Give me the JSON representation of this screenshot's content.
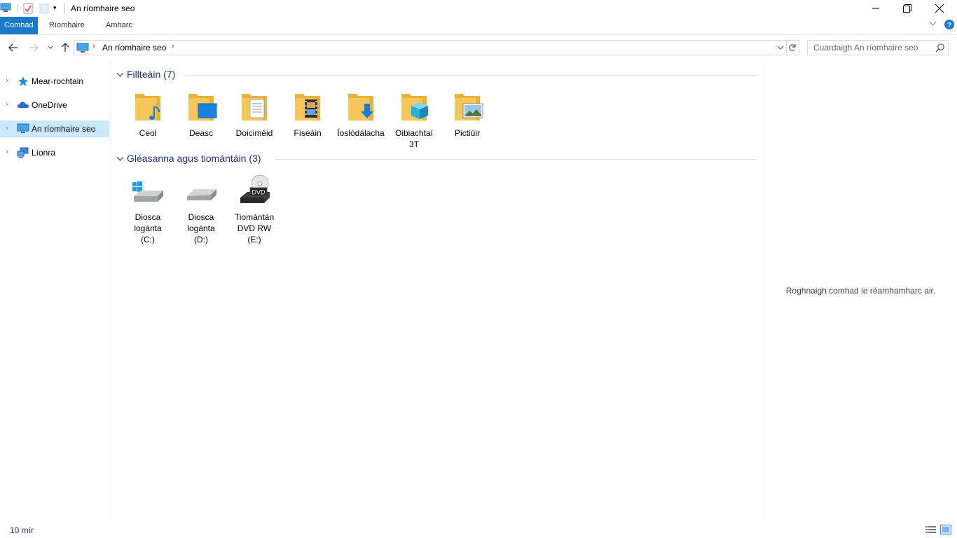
{
  "window": {
    "title": "An ríomhaire seo",
    "controls": {
      "minimize": "—",
      "maximize": "❐",
      "close": "✕"
    }
  },
  "ribbon": {
    "tabs": [
      {
        "label": "Comhad",
        "active": true
      },
      {
        "label": "Ríomhaire",
        "active": false
      },
      {
        "label": "Amharc",
        "active": false
      }
    ],
    "help_icon": "help-icon"
  },
  "address": {
    "path": [
      "An ríomhaire seo"
    ],
    "search_placeholder": "Cuardaigh An ríomhaire seo"
  },
  "nav": {
    "items": [
      {
        "label": "Mear-rochtain",
        "icon": "star-icon",
        "selected": false
      },
      {
        "label": "OneDrive",
        "icon": "cloud-icon",
        "selected": false
      },
      {
        "label": "An ríomhaire seo",
        "icon": "computer-icon",
        "selected": true
      },
      {
        "label": "Líonra",
        "icon": "network-icon",
        "selected": false
      }
    ]
  },
  "content": {
    "folders_group": "Fillteáin (7)",
    "folders": [
      {
        "label": "Ceol",
        "icon": "music-folder-icon"
      },
      {
        "label": "Deasc",
        "icon": "desktop-folder-icon"
      },
      {
        "label": "Doiciméid",
        "icon": "documents-folder-icon"
      },
      {
        "label": "Físeáin",
        "icon": "videos-folder-icon"
      },
      {
        "label": "Íoslódálacha",
        "icon": "downloads-folder-icon"
      },
      {
        "label": "Oibiachtaí 3T",
        "icon": "3d-objects-folder-icon"
      },
      {
        "label": "Pictiúir",
        "icon": "pictures-folder-icon"
      }
    ],
    "devices_group": "Gléasanna agus tiomántáin (3)",
    "devices": [
      {
        "label": "Diosca logánta (C:)",
        "icon": "windows-drive-icon"
      },
      {
        "label": "Diosca logánta (D:)",
        "icon": "drive-icon"
      },
      {
        "label": "Tiomántán DVD RW (E:)",
        "icon": "dvd-drive-icon",
        "badge": "DVD"
      }
    ]
  },
  "preview": {
    "message": "Roghnaigh comhad le réamhamharc air."
  },
  "status": {
    "item_count": "10 mír"
  },
  "colors": {
    "accent": "#1979ca",
    "selected": "#cce8ff",
    "group_heading": "#1e3287",
    "folder": "#f5c65a"
  }
}
